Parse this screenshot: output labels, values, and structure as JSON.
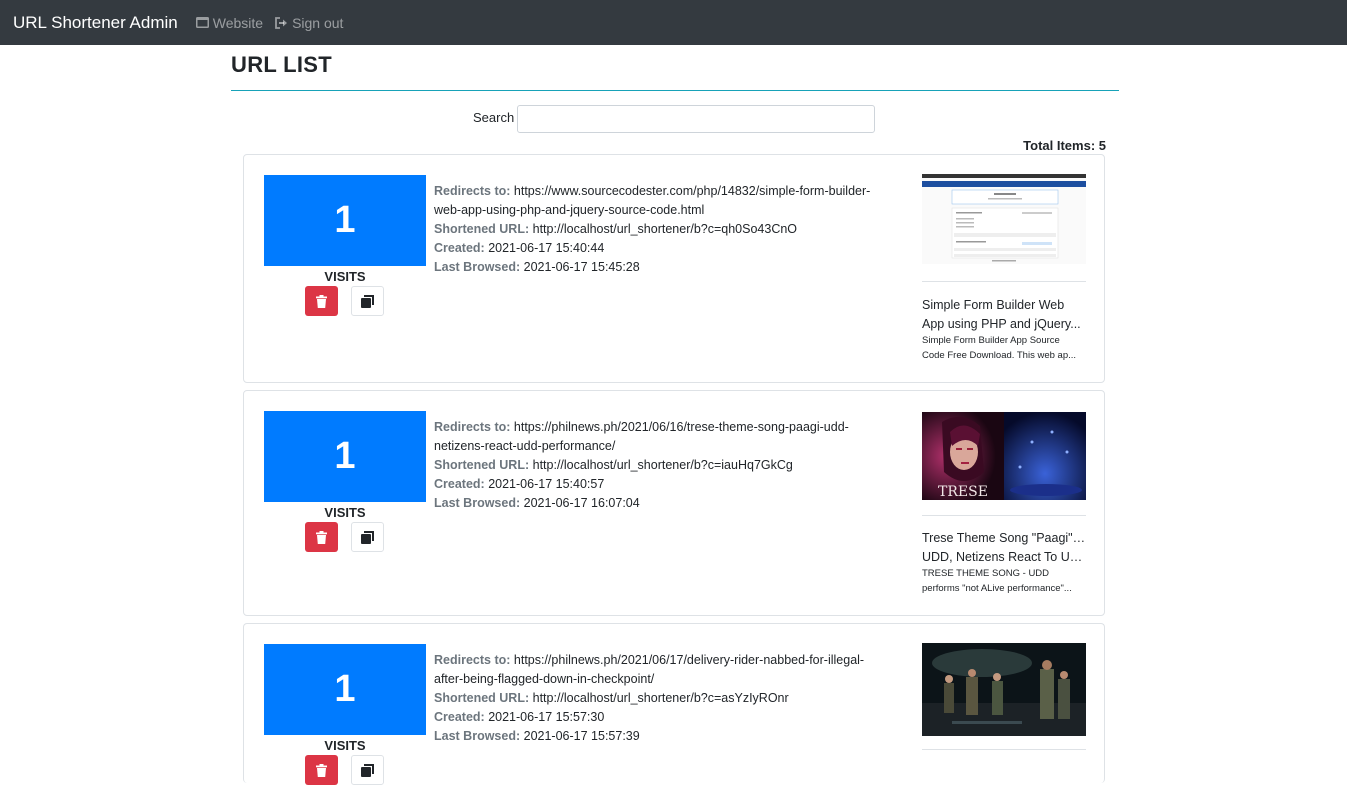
{
  "navbar": {
    "brand": "URL Shortener Admin",
    "links": [
      {
        "label": "Website",
        "icon": "window-icon"
      },
      {
        "label": "Sign out",
        "icon": "sign-out-icon"
      }
    ]
  },
  "page": {
    "title": "URL LIST",
    "search_label": "Search",
    "search_value": "",
    "total_label": "Total Items: 5"
  },
  "labels": {
    "redirect": "Redirects to:",
    "short": "Shortened URL:",
    "created": "Created:",
    "last": "Last Browsed:",
    "visits": "VISITS"
  },
  "items": [
    {
      "visits": "1",
      "redirect_line1": "https://www.sourcecodester.com/php/14832/simple-form-builder-",
      "redirect_line2": "web-app-using-php-and-jquery-source-code.html",
      "short_url": "http://localhost/url_shortener/b?c=qh0So43CnO",
      "created": "2021-06-17 15:40:44",
      "last_browsed": "2021-06-17 15:45:28",
      "preview_title_line1": "Simple Form Builder Web",
      "preview_title_line2": "App using PHP and jQuery...",
      "preview_desc_line1": "Simple Form Builder App Source",
      "preview_desc_line2": "Code Free Download. This web ap..."
    },
    {
      "visits": "1",
      "redirect_line1": "https://philnews.ph/2021/06/16/trese-theme-song-paagi-udd-",
      "redirect_line2": "netizens-react-udd-performance/",
      "short_url": "http://localhost/url_shortener/b?c=iauHq7GkCg",
      "created": "2021-06-17 15:40:57",
      "last_browsed": "2021-06-17 16:07:04",
      "thumb_text": "TRESE",
      "preview_title_line1": "Trese Theme Song \"Paagi\" By",
      "preview_title_line2": "UDD, Netizens React To UD...",
      "preview_desc_line1": "TRESE THEME SONG - UDD",
      "preview_desc_line2": "performs \"not ALive performance\"..."
    },
    {
      "visits": "1",
      "redirect_line1": "https://philnews.ph/2021/06/17/delivery-rider-nabbed-for-illegal-",
      "redirect_line2": "after-being-flagged-down-in-checkpoint/",
      "short_url": "http://localhost/url_shortener/b?c=asYzIyROnr",
      "created": "2021-06-17 15:57:30",
      "last_browsed": "2021-06-17 15:57:39"
    }
  ],
  "colors": {
    "navbar": "#343a40",
    "visits_box": "#007bff",
    "delete_button": "#dc3545",
    "title_rule": "#17a2b8"
  }
}
